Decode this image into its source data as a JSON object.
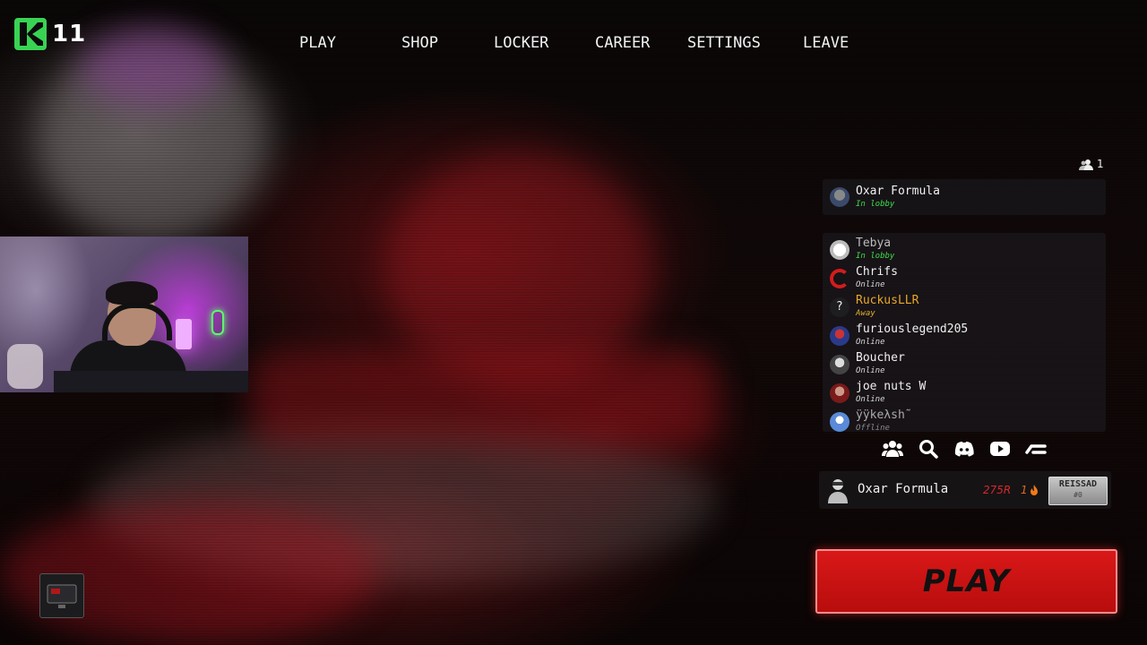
{
  "logo": {
    "number": "11",
    "accent": "#39d353"
  },
  "nav": {
    "items": [
      {
        "label": "PLAY"
      },
      {
        "label": "SHOP"
      },
      {
        "label": "LOCKER"
      },
      {
        "label": "CAREER"
      },
      {
        "label": "SETTINGS"
      },
      {
        "label": "LEAVE"
      }
    ]
  },
  "party": {
    "count": "1",
    "member": {
      "name": "Oxar Formula",
      "status": "In lobby"
    }
  },
  "friends": [
    {
      "name": "Tebya",
      "status": "In lobby",
      "status_color": "#3ddc4a",
      "avatar": "white-circle-avatar"
    },
    {
      "name": "Chrifs",
      "status": "Online",
      "status_color": "#d8d8d8",
      "avatar": "red-ring-avatar"
    },
    {
      "name": "RuckusLLR",
      "status": "Away",
      "status_color": "#e0b030",
      "avatar": "question-mark-avatar"
    },
    {
      "name": "furiouslegend205",
      "status": "Online",
      "status_color": "#d8d8d8",
      "avatar": "character-avatar"
    },
    {
      "name": "Boucher",
      "status": "Online",
      "status_color": "#d8d8d8",
      "avatar": "character-avatar"
    },
    {
      "name": "joe nuts W",
      "status": "Online",
      "status_color": "#d8d8d8",
      "avatar": "character-avatar"
    },
    {
      "name": "ÿÿkeλsh˜",
      "status": "Offline",
      "status_color": "#888888",
      "avatar": "blue-avatar"
    }
  ],
  "social_icons": [
    "friends-icon",
    "search-icon",
    "discord-icon",
    "youtube-icon",
    "link-icon"
  ],
  "player": {
    "name": "Oxar Formula",
    "rp": "275R",
    "streak": "1",
    "rank": "REISSAD",
    "rank_sub": "#0"
  },
  "play_button": {
    "label": "PLAY",
    "color": "#d91818"
  }
}
